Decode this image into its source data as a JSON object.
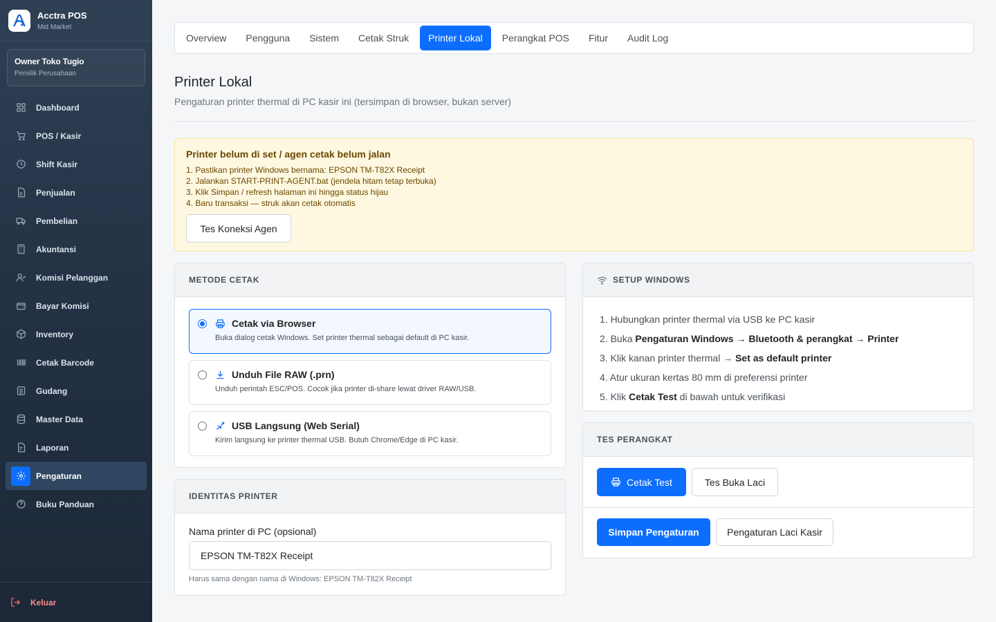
{
  "brand": {
    "name": "Acctra POS",
    "sub": "Mid Market"
  },
  "user": {
    "name": "Owner Toko Tugio",
    "role": "Pemilik Perusahaan"
  },
  "nav": {
    "items": [
      {
        "label": "Dashboard",
        "icon": "grid-icon"
      },
      {
        "label": "POS / Kasir",
        "icon": "cart-icon"
      },
      {
        "label": "Shift Kasir",
        "icon": "clock-icon"
      },
      {
        "label": "Penjualan",
        "icon": "document-icon"
      },
      {
        "label": "Pembelian",
        "icon": "truck-icon"
      },
      {
        "label": "Akuntansi",
        "icon": "calculator-icon"
      },
      {
        "label": "Komisi Pelanggan",
        "icon": "user-check-icon"
      },
      {
        "label": "Bayar Komisi",
        "icon": "wallet-icon"
      },
      {
        "label": "Inventory",
        "icon": "box-icon"
      },
      {
        "label": "Cetak Barcode",
        "icon": "barcode-icon"
      },
      {
        "label": "Gudang",
        "icon": "warehouse-icon"
      },
      {
        "label": "Master Data",
        "icon": "database-icon"
      },
      {
        "label": "Laporan",
        "icon": "report-icon"
      },
      {
        "label": "Pengaturan",
        "icon": "gear-icon",
        "active": true
      },
      {
        "label": "Buku Panduan",
        "icon": "help-icon"
      }
    ],
    "logout": "Keluar"
  },
  "tabs": [
    "Overview",
    "Pengguna",
    "Sistem",
    "Cetak Struk",
    "Printer Lokal",
    "Perangkat POS",
    "Fitur",
    "Audit Log"
  ],
  "active_tab": "Printer Lokal",
  "page": {
    "title": "Printer Lokal",
    "subtitle": "Pengaturan printer thermal di PC kasir ini (tersimpan di browser, bukan server)"
  },
  "alert": {
    "title": "Printer belum di set / agen cetak belum jalan",
    "steps": [
      "1. Pastikan printer Windows bernama: EPSON TM-T82X Receipt",
      "2. Jalankan START-PRINT-AGENT.bat (jendela hitam tetap terbuka)",
      "3. Klik Simpan / refresh halaman ini hingga status hijau",
      "4. Baru transaksi — struk akan cetak otomatis"
    ],
    "button": "Tes Koneksi Agen"
  },
  "metode": {
    "heading": "METODE CETAK",
    "options": [
      {
        "title": "Cetak via Browser",
        "desc": "Buka dialog cetak Windows. Set printer thermal sebagai default di PC kasir.",
        "icon": "printer-icon",
        "selected": true
      },
      {
        "title": "Unduh File RAW (.prn)",
        "desc": "Unduh perintah ESC/POS. Cocok jika printer di-share lewat driver RAW/USB.",
        "icon": "download-icon",
        "selected": false
      },
      {
        "title": "USB Langsung (Web Serial)",
        "desc": "Kirim langsung ke printer thermal USB. Butuh Chrome/Edge di PC kasir.",
        "icon": "usb-icon",
        "selected": false
      }
    ]
  },
  "identitas": {
    "heading": "IDENTITAS PRINTER",
    "label": "Nama printer di PC (opsional)",
    "value": "EPSON TM-T82X Receipt",
    "hint": "Harus sama dengan nama di Windows: EPSON TM-T82X Receipt"
  },
  "setup": {
    "heading": "SETUP WINDOWS",
    "steps": [
      {
        "pre": "1. Hubungkan printer thermal via USB ke PC kasir",
        "bold": "",
        "post": ""
      },
      {
        "pre": "2. Buka ",
        "bold": "Pengaturan Windows → Bluetooth & perangkat → Printer",
        "post": ""
      },
      {
        "pre": "3. Klik kanan printer thermal → ",
        "bold": "Set as default printer",
        "post": ""
      },
      {
        "pre": "4. Atur ukuran kertas 80 mm di preferensi printer",
        "bold": "",
        "post": ""
      },
      {
        "pre": "5. Klik ",
        "bold": "Cetak Test",
        "post": " di bawah untuk verifikasi"
      }
    ]
  },
  "tes": {
    "heading": "TES PERANGKAT",
    "cetak_test": "Cetak Test",
    "buka_laci": "Tes Buka Laci",
    "simpan": "Simpan Pengaturan",
    "laci": "Pengaturan Laci Kasir"
  },
  "colors": {
    "primary": "#0d6efd",
    "sidebar": "#243245",
    "alert_bg": "#fff8e1"
  }
}
